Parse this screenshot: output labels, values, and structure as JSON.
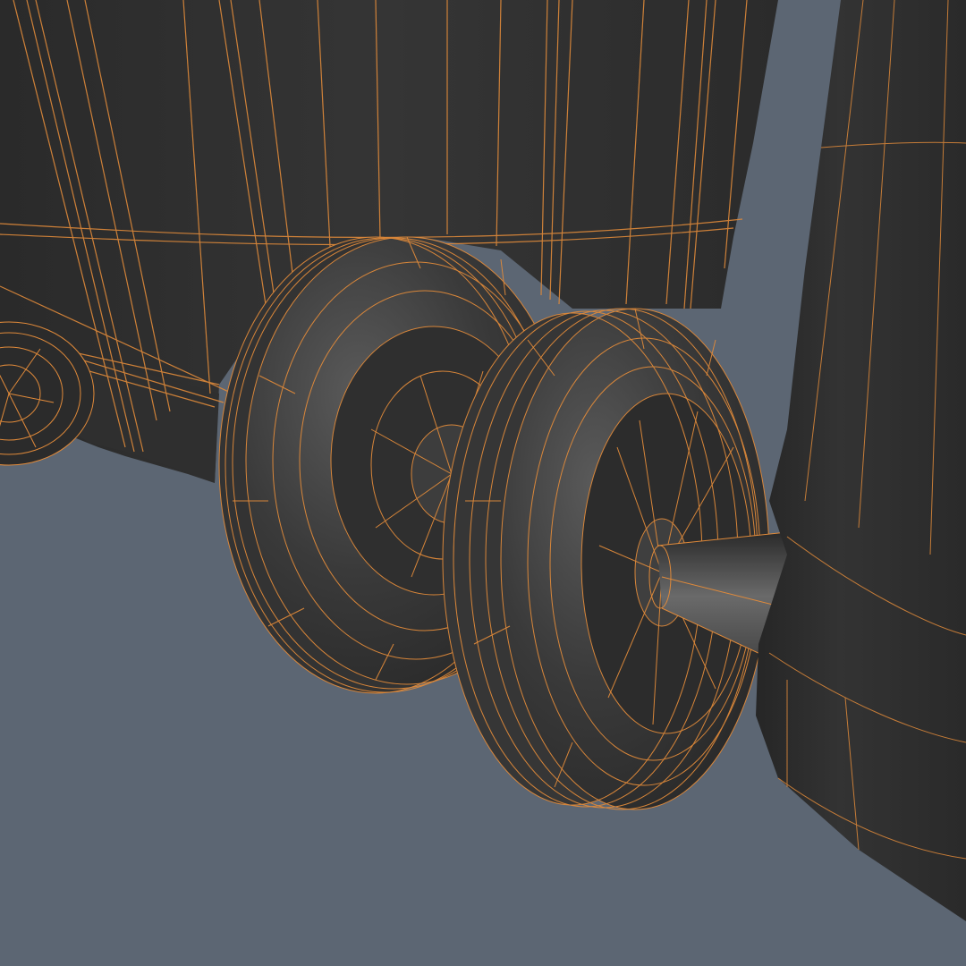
{
  "viewport": {
    "background_color": "#5c6673",
    "mesh_fill_color": "#2e2e2e",
    "mesh_fill_light": "#4a4a4a",
    "wireframe_color": "#e08a3a",
    "shading_mode": "shaded-wireframe"
  },
  "scene": {
    "objects": [
      {
        "name": "wheelie-bin-body",
        "type": "mesh"
      },
      {
        "name": "wheel-left-background",
        "type": "mesh"
      },
      {
        "name": "wheel-rear",
        "type": "mesh"
      },
      {
        "name": "wheel-front",
        "type": "mesh"
      },
      {
        "name": "axle",
        "type": "mesh"
      },
      {
        "name": "second-bin-body",
        "type": "mesh"
      }
    ]
  }
}
